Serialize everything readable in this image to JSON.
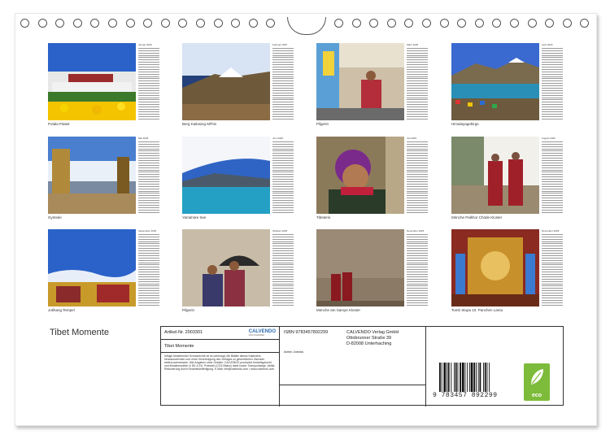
{
  "calendar": {
    "title": "Tibet Momente",
    "months": [
      {
        "month": "Januar",
        "caption": "Potala Palast",
        "scene": "potala"
      },
      {
        "month": "Februar",
        "caption": "Berg Kailasing Mt'hin",
        "scene": "mountain"
      },
      {
        "month": "März",
        "caption": "Pilgerin",
        "scene": "pilgrim"
      },
      {
        "month": "April",
        "caption": "Himalayagebirge",
        "scene": "lake-flags"
      },
      {
        "month": "Mai",
        "caption": "Gyntsée",
        "scene": "roof-statue"
      },
      {
        "month": "Juni",
        "caption": "Yamdroke See",
        "scene": "lake"
      },
      {
        "month": "Juli",
        "caption": "Tibeterin",
        "scene": "woman"
      },
      {
        "month": "August",
        "caption": "Mönche Palkhor Chöde Kloster",
        "scene": "monks"
      },
      {
        "month": "September",
        "caption": "Jokhang Tempel",
        "scene": "temple-sky"
      },
      {
        "month": "Oktober",
        "caption": "Pilgerin",
        "scene": "umbrella"
      },
      {
        "month": "November",
        "caption": "Mönche am Samye Kloster",
        "scene": "wall-monks"
      },
      {
        "month": "Dezember",
        "caption": "Tomb Stupa 10. Panchen Lama",
        "scene": "stupa"
      }
    ],
    "year_suffix": "2025"
  },
  "info_box": {
    "article_label": "Artikel-Nr. 2003301",
    "logo": "CALVENDO",
    "logo_sub": "DAS KALENDER",
    "product_title": "Tibet Momente",
    "legal_text": "Infolge bestehender Schutzrechte ist es untersagt, die Blätter dieses Kalenders herauszutrennen und ohne Genehmigung des Verlages zu gewerblichen Zwecken weiterzuverwenden. Alle Angaben ohne Gewähr. CALVENDO produziert bedarfsgerecht und klimafreundlich in DE & EU. Preisinfo (CO2-Bilanz) dank kurzer Transportwege. Abfall-Reduzierung durch Einzelstückfertigung. E-Mail: info@calvendo.com • www.calvendo.com",
    "isbn": "ISBN 9783457892299",
    "author": "Armin Joecks",
    "publisher_lines": [
      "CALVENDO Verlag GmbH",
      "Ottobrunner Straße 39",
      "D-82008 Unterhaching"
    ],
    "barcode_text": "9 783457 892299",
    "eco_label": "eco"
  },
  "colors": {
    "sky": "#2a62c9",
    "eco_green": "#7dbb3a"
  }
}
